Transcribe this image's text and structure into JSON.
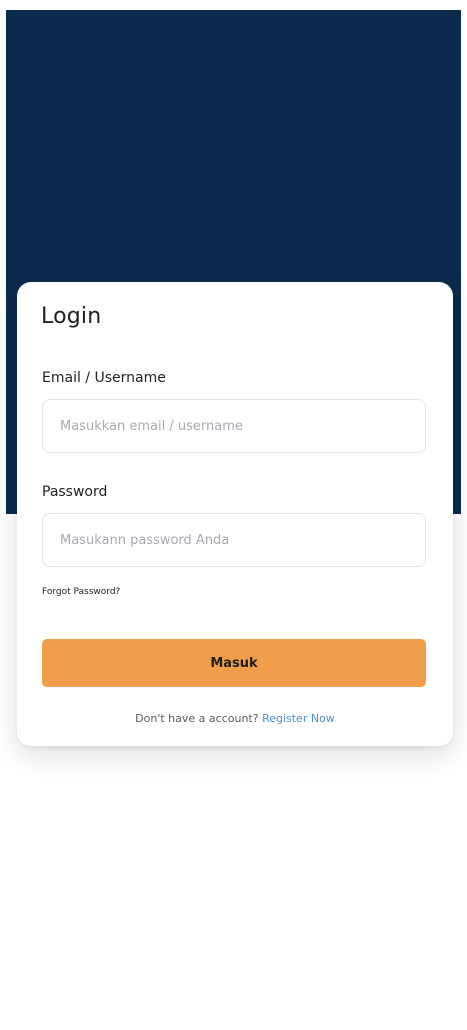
{
  "login": {
    "title": "Login",
    "email_label": "Email / Username",
    "email_placeholder": "Masukkan email / username",
    "password_label": "Password",
    "password_placeholder": "Masukann password Anda",
    "forgot_label": "Forgot Password?",
    "submit_label": "Masuk",
    "register_prompt": "Don't have a account?",
    "register_link": "Register Now"
  },
  "colors": {
    "header_background": "#0b2b4c",
    "button_background": "#f09e4b",
    "link": "#4a8fd6"
  }
}
